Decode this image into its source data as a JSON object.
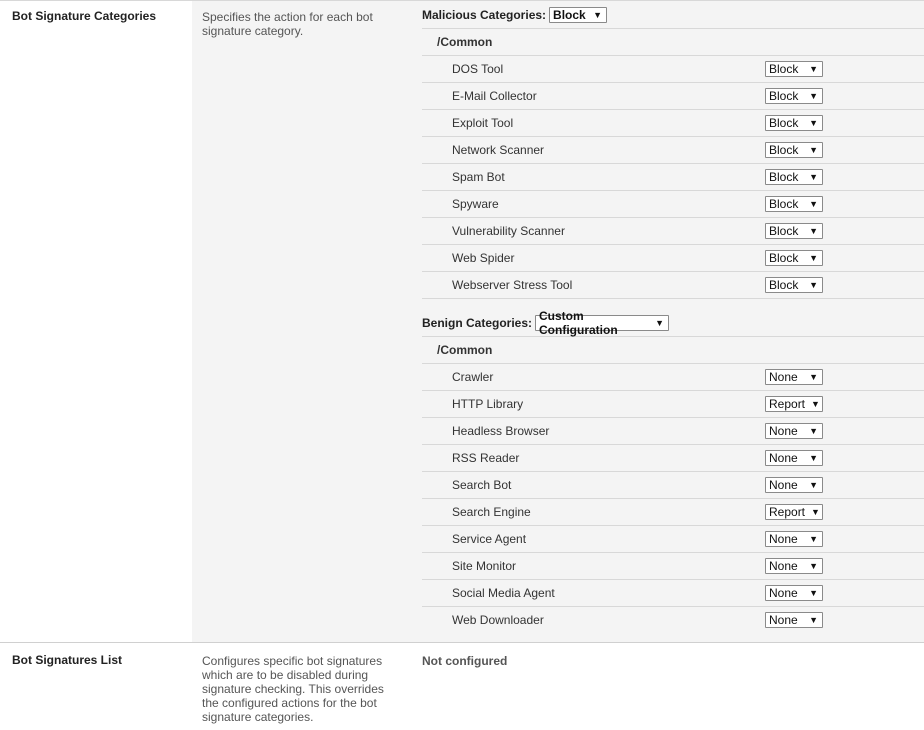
{
  "rows": [
    {
      "label": "Bot Signature Categories",
      "description": "Specifies the action for each bot signature category."
    },
    {
      "label": "Bot Signatures List",
      "description": "Configures specific bot signatures which are to be disabled during signature checking. This overrides the configured actions for the bot signature categories.",
      "value": "Not configured"
    }
  ],
  "malicious": {
    "label": "Malicious Categories:",
    "selected": "Block",
    "group": "/Common",
    "items": [
      {
        "name": "DOS Tool",
        "action": "Block"
      },
      {
        "name": "E-Mail Collector",
        "action": "Block"
      },
      {
        "name": "Exploit Tool",
        "action": "Block"
      },
      {
        "name": "Network Scanner",
        "action": "Block"
      },
      {
        "name": "Spam Bot",
        "action": "Block"
      },
      {
        "name": "Spyware",
        "action": "Block"
      },
      {
        "name": "Vulnerability Scanner",
        "action": "Block"
      },
      {
        "name": "Web Spider",
        "action": "Block"
      },
      {
        "name": "Webserver Stress Tool",
        "action": "Block"
      }
    ]
  },
  "benign": {
    "label": "Benign Categories:",
    "selected": "Custom Configuration",
    "group": "/Common",
    "items": [
      {
        "name": "Crawler",
        "action": "None"
      },
      {
        "name": "HTTP Library",
        "action": "Report"
      },
      {
        "name": "Headless Browser",
        "action": "None"
      },
      {
        "name": "RSS Reader",
        "action": "None"
      },
      {
        "name": "Search Bot",
        "action": "None"
      },
      {
        "name": "Search Engine",
        "action": "Report"
      },
      {
        "name": "Service Agent",
        "action": "None"
      },
      {
        "name": "Site Monitor",
        "action": "None"
      },
      {
        "name": "Social Media Agent",
        "action": "None"
      },
      {
        "name": "Web Downloader",
        "action": "None"
      }
    ]
  },
  "icons": {
    "dropdown": "dropdown-arrow-icon",
    "arrow_glyph": "▼"
  }
}
